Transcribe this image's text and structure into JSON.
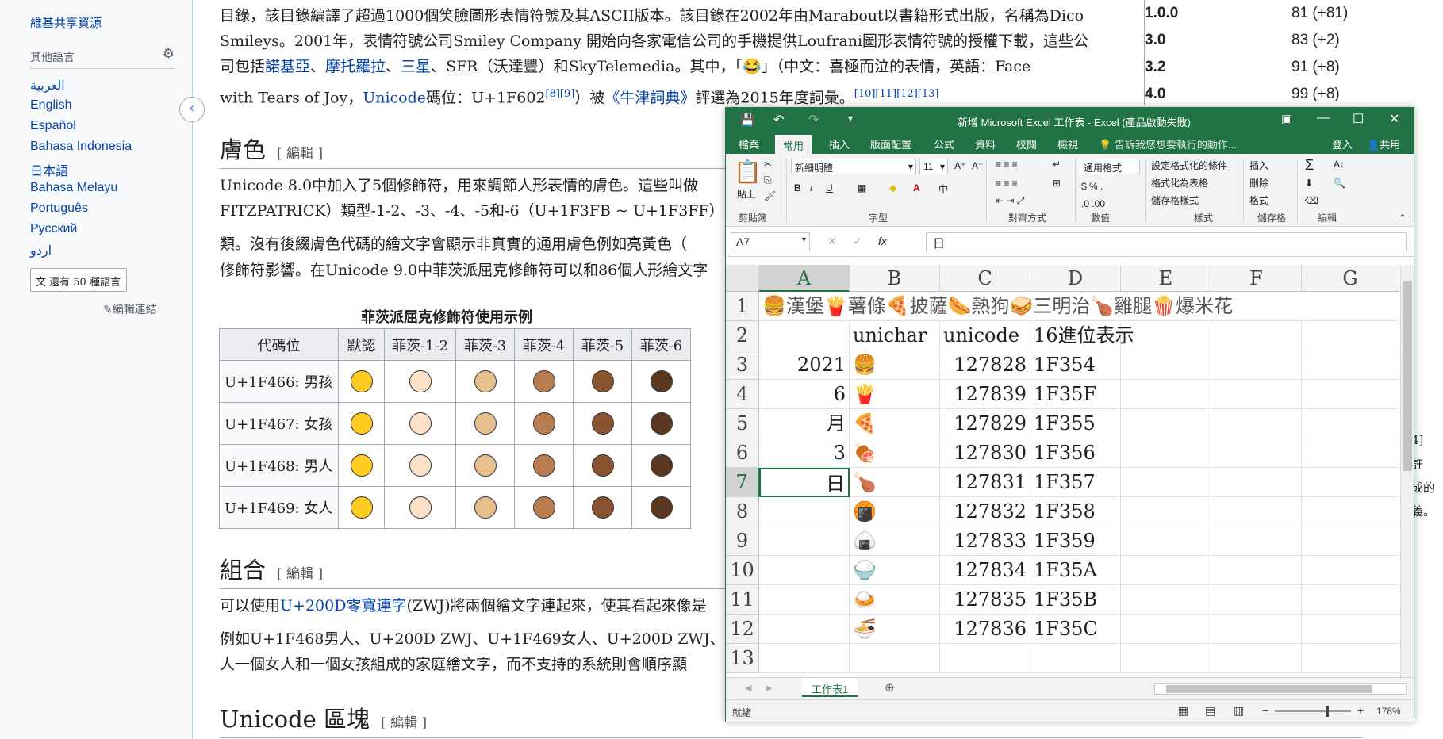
{
  "sidebar": {
    "top_link": "維基共享資源",
    "languages_title": "其他語言",
    "languages": [
      "العربية",
      "English",
      "Español",
      "Bahasa Indonesia",
      "日本語",
      "Bahasa Melayu",
      "Português",
      "Русский",
      "اردو"
    ],
    "more_languages": "還有 50 種語言",
    "edit_links": "✎編輯連結"
  },
  "article": {
    "intro_line1": "目錄，該目錄編譯了超過1000個笑臉圖形表情符號及其ASCII版本。該目錄在2002年由Marabout以書籍形式出版，名稱為Dico",
    "intro_line2": "Smileys。2001年，表情符號公司Smiley Company 開始向各家電信公司的手機提供Loufrani圖形表情符號的授權下載，這些公",
    "intro_line3_a": "司包括",
    "intro_line3_links": [
      "諾基亞",
      "摩托羅拉",
      "三星"
    ],
    "intro_line3_b": "、SFR（沃達豐）和SkyTelemedia。其中，「😂」（中文：喜極而泣的表情，英語：Face",
    "intro_line4_a": "with Tears of Joy，",
    "intro_line4_link": "Unicode",
    "intro_line4_b": "碼位：U+1F602",
    "intro_line4_refs1": "[8][9]",
    "intro_line4_c": "）被",
    "intro_line4_link2": "《牛津詞典》",
    "intro_line4_d": "評選為2015年度詞彙。",
    "intro_line4_refs2": "[10][11][12][13]",
    "h_skin": "膚色",
    "edit_label": "[ 編輯 ]",
    "skin_p1": "Unicode 8.0中加入了5個修飾符，用來調節人形表情的膚色。這些叫做",
    "skin_p2": "FITZPATRICK）類型-1-2、-3、-4、-5和-6（U+1F3FB ~ U+1F3FF）□",
    "skin_p3": "類。沒有後綴膚色代碼的繪文字會顯示非真實的通用膚色例如亮黃色（",
    "skin_p4": "修飾符影響。在Unicode 9.0中菲茨派屈克修飾符可以和86個人形繪文字",
    "table_caption": "菲茨派屈克修飾符使用示例",
    "table_headers": [
      "代碼位",
      "默認",
      "菲茨-1-2",
      "菲茨-3",
      "菲茨-4",
      "菲茨-5",
      "菲茨-6"
    ],
    "table_rows": [
      "U+1F466: 男孩",
      "U+1F467: 女孩",
      "U+1F468: 男人",
      "U+1F469: 女人"
    ],
    "h_combine": "組合",
    "combine_p1_a": "可以使用",
    "combine_p1_link": "U+200D零寬連字",
    "combine_p1_b": "(ZWJ)將兩個繪文字連起來，使其看起來像是",
    "combine_p2": "例如U+1F468男人、U+200D ZWJ、U+1F469女人、U+200D ZWJ、U",
    "combine_p3": "人一個女人和一個女孩組成的家庭繪文字，而不支持的系統則會順序顯",
    "h_unicode": "Unicode 區塊",
    "side_note": [
      "4]許",
      "成的",
      "義。"
    ]
  },
  "right_table": {
    "rows": [
      {
        "ver": "1.0.0",
        "count": "81 (+81)"
      },
      {
        "ver": "3.0",
        "count": "83 (+2)"
      },
      {
        "ver": "3.2",
        "count": "91 (+8)"
      },
      {
        "ver": "4.0",
        "count": "99 (+8)"
      }
    ]
  },
  "excel": {
    "title": "新增 Microsoft Excel 工作表 - Excel (產品啟動失敗)",
    "tabs": [
      "檔案",
      "常用",
      "插入",
      "版面配置",
      "公式",
      "資料",
      "校閱",
      "檢視"
    ],
    "tell_me": "告訴我您想要執行的動作...",
    "signin": "登入",
    "share": "共用",
    "font_name": "新細明體",
    "font_size": "11",
    "number_format": "通用格式",
    "groups": [
      "剪貼簿",
      "字型",
      "對齊方式",
      "數值",
      "樣式",
      "儲存格",
      "編輯"
    ],
    "paste": "貼上",
    "style_buttons": [
      "設定格式化的條件",
      "格式化為表格",
      "儲存格樣式"
    ],
    "cell_buttons": [
      "插入",
      "刪除",
      "格式"
    ],
    "name_box": "A7",
    "formula": "日",
    "columns": [
      "A",
      "B",
      "C",
      "D",
      "E",
      "F",
      "G"
    ],
    "row_numbers": [
      "1",
      "2",
      "3",
      "4",
      "5",
      "6",
      "7",
      "8",
      "9",
      "10",
      "11",
      "12",
      "13"
    ],
    "row1_text": "🍔漢堡🍟薯條🍕披薩🌭熱狗🥪三明治🍗雞腿🍿爆米花",
    "header_row": {
      "b": "unichar",
      "c": "unicode",
      "d": "16進位表示"
    },
    "rows": [
      {
        "a": "2021",
        "b": "🍔",
        "c": "127828",
        "d": "1F354"
      },
      {
        "a": "6",
        "b": "🍟",
        "c": "127839",
        "d": "1F35F"
      },
      {
        "a": "月",
        "b": "🍕",
        "c": "127829",
        "d": "1F355"
      },
      {
        "a": "3",
        "b": "🍖",
        "c": "127830",
        "d": "1F356"
      },
      {
        "a": "日",
        "b": "🍗",
        "c": "127831",
        "d": "1F357"
      },
      {
        "a": "",
        "b": "🍘",
        "c": "127832",
        "d": "1F358"
      },
      {
        "a": "",
        "b": "🍙",
        "c": "127833",
        "d": "1F359"
      },
      {
        "a": "",
        "b": "🍚",
        "c": "127834",
        "d": "1F35A"
      },
      {
        "a": "",
        "b": "🍛",
        "c": "127835",
        "d": "1F35B"
      },
      {
        "a": "",
        "b": "🍜",
        "c": "127836",
        "d": "1F35C"
      }
    ],
    "sheet_tab": "工作表1",
    "status": "就緒",
    "zoom": "178%"
  },
  "colors": {
    "excel_green": "#217346",
    "link": "#0645ad"
  }
}
